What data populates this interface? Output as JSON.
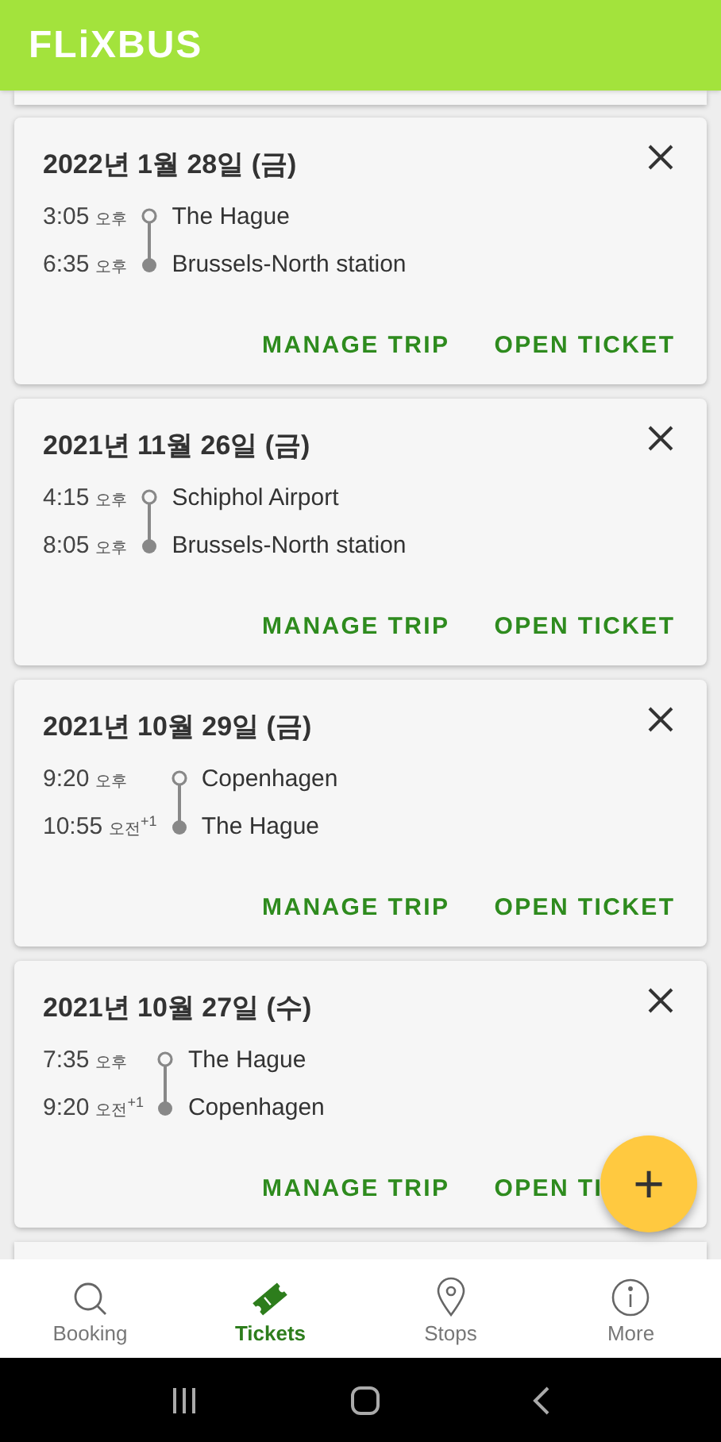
{
  "header": {
    "logo": "FLiXBUS"
  },
  "trips": [
    {
      "date": "2022년 1월 28일 (금)",
      "stops": [
        {
          "time": "3:05",
          "period": "오후",
          "place": "The Hague"
        },
        {
          "time": "6:35",
          "period": "오후",
          "place": "Brussels-North station"
        }
      ],
      "actions": [
        "MANAGE TRIP",
        "OPEN TICKET"
      ]
    },
    {
      "date": "2021년 11월 26일 (금)",
      "stops": [
        {
          "time": "4:15",
          "period": "오후",
          "place": "Schiphol Airport"
        },
        {
          "time": "8:05",
          "period": "오후",
          "place": "Brussels-North station"
        }
      ],
      "actions": [
        "MANAGE TRIP",
        "OPEN TICKET"
      ]
    },
    {
      "date": "2021년 10월 29일 (금)",
      "stops": [
        {
          "time": "9:20",
          "period": "오후",
          "place": "Copenhagen"
        },
        {
          "time": "10:55",
          "period": "오전",
          "day_offset": "+1",
          "place": "The Hague"
        }
      ],
      "actions": [
        "MANAGE TRIP",
        "OPEN TICKET"
      ]
    },
    {
      "date": "2021년 10월 27일 (수)",
      "stops": [
        {
          "time": "7:35",
          "period": "오후",
          "place": "The Hague"
        },
        {
          "time": "9:20",
          "period": "오전",
          "day_offset": "+1",
          "place": "Copenhagen"
        }
      ],
      "actions": [
        "MANAGE TRIP",
        "OPEN TI"
      ]
    }
  ],
  "fab": {
    "label": "+"
  },
  "nav": [
    {
      "label": "Booking",
      "kind": "search",
      "selected": false
    },
    {
      "label": "Tickets",
      "kind": "ticket",
      "selected": true
    },
    {
      "label": "Stops",
      "kind": "pin",
      "selected": false
    },
    {
      "label": "More",
      "kind": "info",
      "selected": false
    }
  ]
}
